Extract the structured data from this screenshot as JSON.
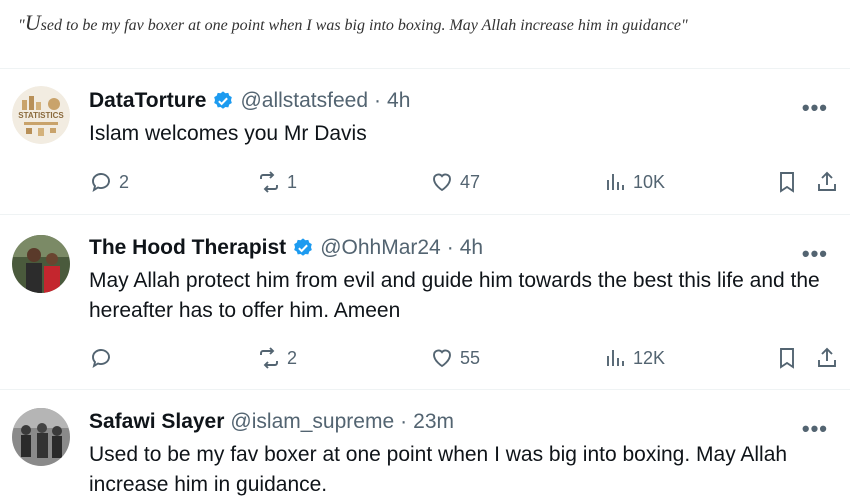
{
  "quote": {
    "open_mark": "\"",
    "first_letter": "U",
    "rest": "sed to be my fav boxer at one point when I was big into boxing. May Allah increase him in guidance\""
  },
  "tweets": [
    {
      "name": "DataTorture",
      "handle": "@allstatsfeed",
      "sep": "·",
      "time": "4h",
      "text": "Islam welcomes you Mr Davis",
      "replies": "2",
      "retweets": "1",
      "likes": "47",
      "views": "10K",
      "avatar_label": "STATISTICS"
    },
    {
      "name": "The Hood Therapist",
      "handle": "@OhhMar24",
      "sep": "·",
      "time": "4h",
      "text": "May Allah protect him from evil and guide him towards the best this life and the hereafter has to offer him. Ameen",
      "replies": "",
      "retweets": "2",
      "likes": "55",
      "views": "12K"
    },
    {
      "name": "Safawi Slayer",
      "handle": "@islam_supreme",
      "sep": "·",
      "time": "23m",
      "text": "Used to be my fav boxer at one point when I was big into boxing. May Allah increase him in guidance."
    }
  ],
  "more_label": "•••",
  "colors": {
    "verified": "#1d9bf0",
    "muted": "#536471",
    "text": "#0f1419"
  }
}
